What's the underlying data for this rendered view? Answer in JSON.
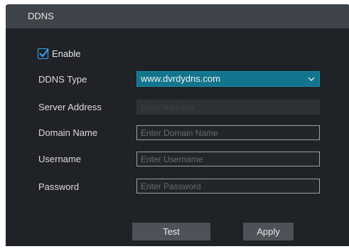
{
  "window": {
    "title": "DDNS"
  },
  "enable": {
    "label": "Enable",
    "checked": true
  },
  "ddns_type": {
    "label": "DDNS Type",
    "value": "www.dvrdydns.com"
  },
  "server_address": {
    "label": "Server Address",
    "placeholder": "Enter Address"
  },
  "domain_name": {
    "label": "Domain Name",
    "placeholder": "Enter Domain Name"
  },
  "username": {
    "label": "Username",
    "placeholder": "Enter Username"
  },
  "password": {
    "label": "Password",
    "placeholder": "Enter Password"
  },
  "buttons": {
    "test": "Test",
    "apply": "Apply"
  },
  "colors": {
    "panel_bg": "#1f2226",
    "titlebar_bg": "#3e4349",
    "select_bg": "#12758d",
    "checkbox_accent": "#3aa8f0",
    "button_bg": "#4e5258"
  },
  "icons": {
    "check": "checkmark-icon",
    "dropdown": "chevron-down-icon"
  }
}
